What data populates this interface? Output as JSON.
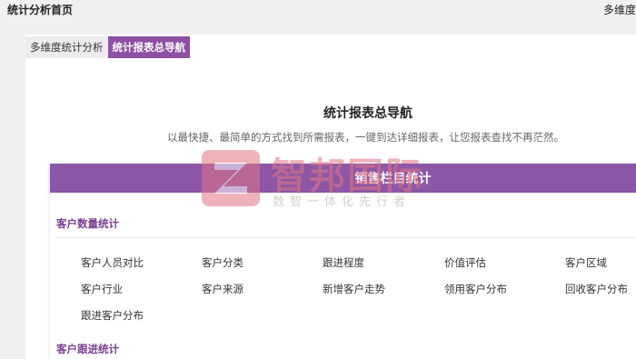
{
  "topbar": {
    "title": "统计分析首页",
    "right_text": "多维度"
  },
  "tabs": [
    {
      "label": "多维度统计分析",
      "active": false
    },
    {
      "label": "统计报表总导航",
      "active": true
    }
  ],
  "main": {
    "heading": "统计报表总导航",
    "subheading": "以最快捷、最简单的方式找到所需报表，一键到达详细报表，让您报表查找不再茫然。"
  },
  "banner": {
    "label": "销售栏目统计"
  },
  "sections": [
    {
      "title": "客户数量统计",
      "items": [
        [
          "客户人员对比",
          "客户分类",
          "跟进程度",
          "价值评估",
          "客户区域"
        ],
        [
          "客户行业",
          "客户来源",
          "新增客户走势",
          "领用客户分布",
          "回收客户分布"
        ],
        [
          "跟进客户分布"
        ]
      ]
    },
    {
      "title": "客户跟进统计",
      "items": []
    }
  ],
  "watermark": {
    "name": "智邦国际",
    "slogan": "数智一体化先行者"
  },
  "colors": {
    "accent": "#8e4fa4",
    "banner": "#8b57a6",
    "section_title": "#7a3e95",
    "watermark": "#e27585"
  }
}
